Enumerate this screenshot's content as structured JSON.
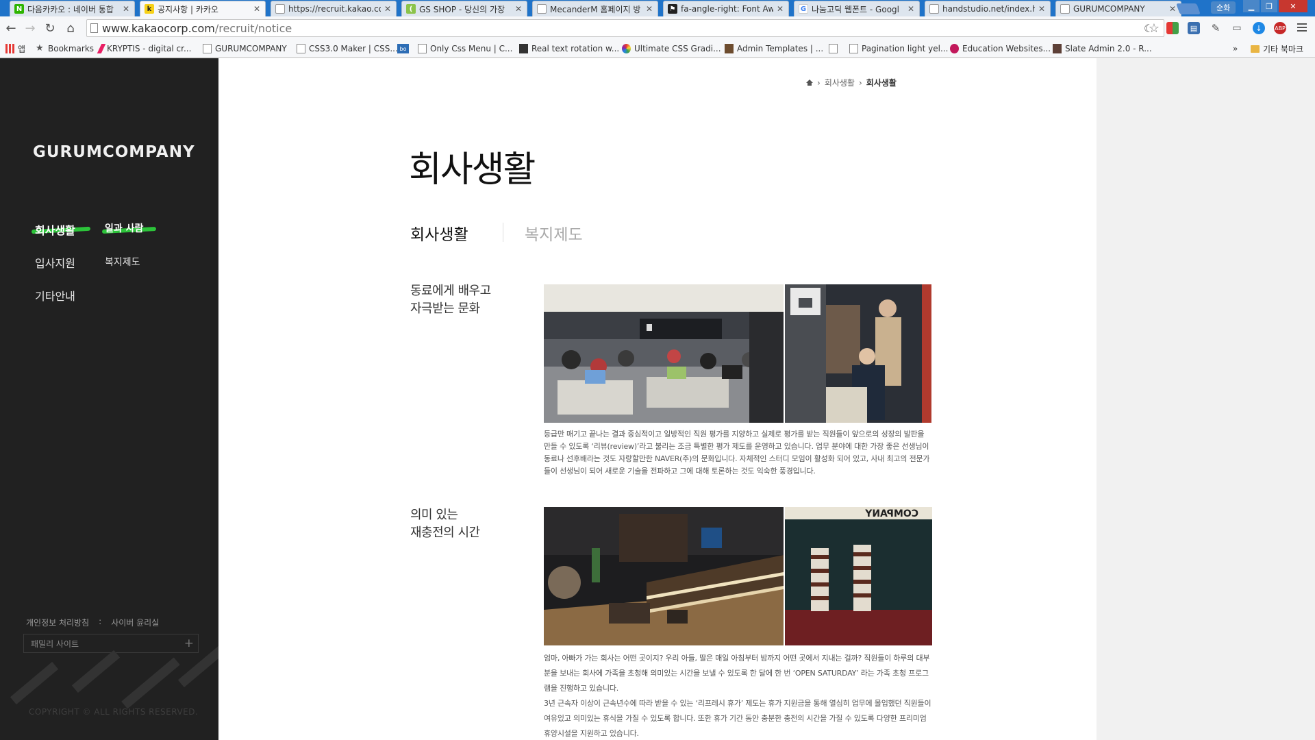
{
  "browser": {
    "tabs": [
      {
        "title": "다음카카오 : 네이버 통합",
        "favicon_color": "#2db400",
        "favicon_char": "N"
      },
      {
        "title": "공지사항 | 카카오",
        "favicon_color": "#f7d117",
        "favicon_char": "k"
      },
      {
        "title": "https://recruit.kakao.com",
        "favicon_color": "#9aa0a6",
        "favicon_char": ""
      },
      {
        "title": "GS SHOP - 당신의 가장",
        "favicon_color": "#8bc34a",
        "favicon_char": "("
      },
      {
        "title": "MecanderM 홈페이지 방",
        "favicon_color": "#9aa0a6",
        "favicon_char": ""
      },
      {
        "title": "fa-angle-right: Font Awe",
        "favicon_color": "#222222",
        "favicon_char": "⚑"
      },
      {
        "title": "나눔고딕 웹폰트 - Googl",
        "favicon_color": "#4285f4",
        "favicon_char": "G"
      },
      {
        "title": "handstudio.net/index.htm",
        "favicon_color": "#9aa0a6",
        "favicon_char": ""
      },
      {
        "title": "GURUMCOMPANY",
        "favicon_color": "#9aa0a6",
        "favicon_char": ""
      }
    ],
    "user_label": "순화",
    "url_host": "www.kakaocorp.com",
    "url_path": "/recruit/notice",
    "bookmarks": [
      {
        "label": "앱",
        "icon": "apps-icon"
      },
      {
        "label": "Bookmarks",
        "icon": "star-icon"
      },
      {
        "label": "KRYPTIS - digital cr...",
        "icon": "kryptis-icon"
      },
      {
        "label": "GURUMCOMPANY",
        "icon": "page-icon"
      },
      {
        "label": "CSS3.0 Maker | CSS...",
        "icon": "page-icon"
      },
      {
        "label": "",
        "icon": "bo-icon"
      },
      {
        "label": "Only Css Menu | C...",
        "icon": "page-icon"
      },
      {
        "label": "Real text rotation w...",
        "icon": "image-icon"
      },
      {
        "label": "Ultimate CSS Gradi...",
        "icon": "gradient-icon"
      },
      {
        "label": "Admin Templates | ...",
        "icon": "image-icon"
      },
      {
        "label": "",
        "icon": "page-icon"
      },
      {
        "label": "Pagination light yel...",
        "icon": "page-icon"
      },
      {
        "label": "Education Websites...",
        "icon": "shield-icon"
      },
      {
        "label": "Slate Admin 2.0 - R...",
        "icon": "image-icon"
      }
    ],
    "bookmarks_overflow": "»",
    "other_bookmarks": "기타 북마크"
  },
  "sidebar": {
    "logo": "GURUMCOMPANY",
    "nav": {
      "item1": "회사생활",
      "item2": "일과 사람",
      "item3": "입사지원",
      "item4": "복지제도",
      "item5": "기타안내"
    },
    "policy_privacy": "개인정보 처리방침",
    "policy_sep": ":",
    "policy_cyber": "사이버 윤리실",
    "family_site": "패밀리 사이트",
    "copyright": "COPYRIGHT ©  ALL RIGHTS RESERVED."
  },
  "main": {
    "breadcrumb": {
      "level1": "회사생활",
      "current": "회사생활"
    },
    "title": "회사생활",
    "tabs": {
      "active": "회사생활",
      "inactive": "복지제도"
    },
    "section1": {
      "heading_line1": "동료에게 배우고",
      "heading_line2": "자극받는 문화",
      "text": "등급만 매기고 끝나는 결과 중심적이고 일방적인 직원 평가를 지양하고 실제로 평가를 받는 직원들이 앞으로의 성장의 발판을 만들 수 있도록 ‘리뷰(review)’라고 불리는 조금 특별한 평가 제도를 운영하고 있습니다. 업무 분야에 대한 가장 좋은 선생님이 동료나 선후배라는 것도 자랑할만한 NAVER(주)의 문화입니다. 자체적인 스터디 모임이 활성화 되어 있고, 사내 최고의 전문가들이 선생님이 되어 새로운 기술을 전파하고 그에 대해 토론하는 것도 익숙한 풍경입니다."
    },
    "section2": {
      "heading_line1": "의미 있는",
      "heading_line2": "재충전의 시간",
      "text_p1": "엄마, 아빠가 가는 회사는 어떤 곳이지? 우리 아들, 딸은 매일 아침부터 밤까지 어떤 곳에서 지내는 걸까? 직원들이 하루의 대부분을 보내는 회사에 가족을 초청해 의미있는 시간을 보낼 수 있도록 한 달에 한 번 ‘OPEN SATURDAY’ 라는 가족 초청 프로그램을 진행하고 있습니다.",
      "text_p2": "3년 근속자 이상이 근속년수에 따라 받을 수 있는 ‘리프레시 휴가’ 제도는 휴가 지원금을 통해 열심히 업무에 몰입했던 직원들이 여유있고 의미있는 휴식을 가질 수 있도록 합니다. 또한 휴가 기간 동안 충분한 충전의 시간을 가질 수 있도록 다양한 프리미엄 휴양시설을 지원하고 있습니다."
    }
  }
}
